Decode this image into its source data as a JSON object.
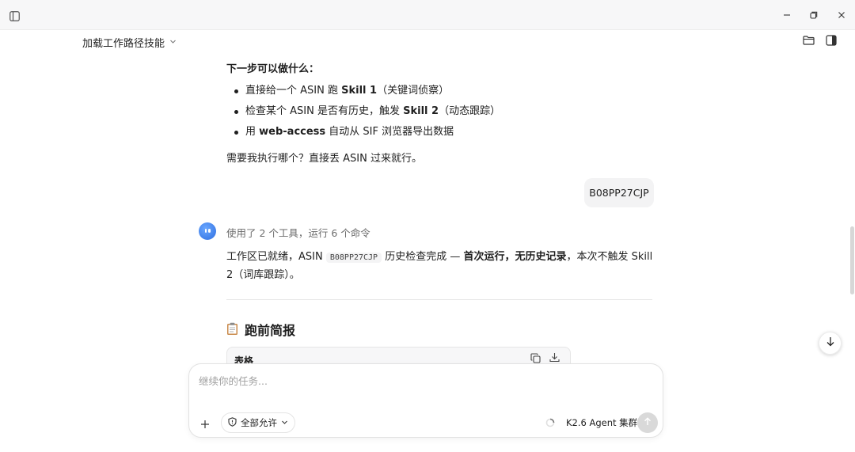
{
  "window": {
    "sidebar_toggle_icon": "sidebar-icon",
    "minimize_icon": "minimize-icon",
    "restore_icon": "restore-icon",
    "close_icon": "close-icon"
  },
  "header": {
    "title": "加载工作路径技能",
    "folder_icon": "folder-icon",
    "panel_icon": "panel-icon"
  },
  "messages": {
    "next_steps": {
      "heading": "下一步可以做什么：",
      "items": [
        {
          "pre": "直接给一个 ASIN 跑 ",
          "bold": "Skill 1",
          "post": "（关键词侦察）"
        },
        {
          "pre": "检查某个 ASIN 是否有历史，触发 ",
          "bold": "Skill 2",
          "post": "（动态跟踪）"
        },
        {
          "pre": "用 ",
          "bold": "web-access",
          "post": " 自动从 SIF 浏览器导出数据"
        }
      ],
      "ask": "需要我执行哪个？直接丢 ASIN 过来就行。"
    },
    "user_message": "B08PP27CJP",
    "assistant": {
      "tools_summary": "使用了 2 个工具，运行 6 个命令",
      "result": {
        "part1": "工作区已就绪，ASIN",
        "code": "B08PP27CJP",
        "part2": "历史检查完成 — ",
        "bold": "首次运行，无历史记录",
        "part3": "，本次不触发 Skill 2（词库跟踪）。"
      },
      "brief_title": "跑前简报",
      "brief_icon": "clipboard-icon",
      "table_label": "表格"
    }
  },
  "composer": {
    "placeholder": "继续你的任务...",
    "permission_label": "全部允许",
    "model_label": "K2.6 Agent 集群"
  },
  "colors": {
    "background": "#ffffff",
    "titlebar": "#f7f7f8",
    "bubble": "#f3f3f4",
    "avatar": "#3b7be8",
    "send_button": "#d9d9d9"
  }
}
